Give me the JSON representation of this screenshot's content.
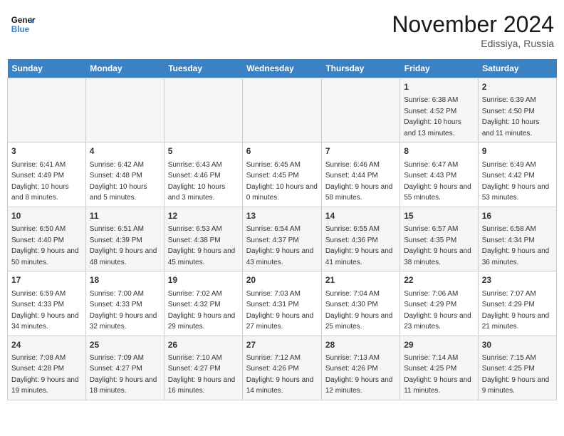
{
  "header": {
    "logo_line1": "General",
    "logo_line2": "Blue",
    "month": "November 2024",
    "location": "Edissiya, Russia"
  },
  "days_of_week": [
    "Sunday",
    "Monday",
    "Tuesday",
    "Wednesday",
    "Thursday",
    "Friday",
    "Saturday"
  ],
  "weeks": [
    [
      {
        "day": "",
        "info": ""
      },
      {
        "day": "",
        "info": ""
      },
      {
        "day": "",
        "info": ""
      },
      {
        "day": "",
        "info": ""
      },
      {
        "day": "",
        "info": ""
      },
      {
        "day": "1",
        "info": "Sunrise: 6:38 AM\nSunset: 4:52 PM\nDaylight: 10 hours and 13 minutes."
      },
      {
        "day": "2",
        "info": "Sunrise: 6:39 AM\nSunset: 4:50 PM\nDaylight: 10 hours and 11 minutes."
      }
    ],
    [
      {
        "day": "3",
        "info": "Sunrise: 6:41 AM\nSunset: 4:49 PM\nDaylight: 10 hours and 8 minutes."
      },
      {
        "day": "4",
        "info": "Sunrise: 6:42 AM\nSunset: 4:48 PM\nDaylight: 10 hours and 5 minutes."
      },
      {
        "day": "5",
        "info": "Sunrise: 6:43 AM\nSunset: 4:46 PM\nDaylight: 10 hours and 3 minutes."
      },
      {
        "day": "6",
        "info": "Sunrise: 6:45 AM\nSunset: 4:45 PM\nDaylight: 10 hours and 0 minutes."
      },
      {
        "day": "7",
        "info": "Sunrise: 6:46 AM\nSunset: 4:44 PM\nDaylight: 9 hours and 58 minutes."
      },
      {
        "day": "8",
        "info": "Sunrise: 6:47 AM\nSunset: 4:43 PM\nDaylight: 9 hours and 55 minutes."
      },
      {
        "day": "9",
        "info": "Sunrise: 6:49 AM\nSunset: 4:42 PM\nDaylight: 9 hours and 53 minutes."
      }
    ],
    [
      {
        "day": "10",
        "info": "Sunrise: 6:50 AM\nSunset: 4:40 PM\nDaylight: 9 hours and 50 minutes."
      },
      {
        "day": "11",
        "info": "Sunrise: 6:51 AM\nSunset: 4:39 PM\nDaylight: 9 hours and 48 minutes."
      },
      {
        "day": "12",
        "info": "Sunrise: 6:53 AM\nSunset: 4:38 PM\nDaylight: 9 hours and 45 minutes."
      },
      {
        "day": "13",
        "info": "Sunrise: 6:54 AM\nSunset: 4:37 PM\nDaylight: 9 hours and 43 minutes."
      },
      {
        "day": "14",
        "info": "Sunrise: 6:55 AM\nSunset: 4:36 PM\nDaylight: 9 hours and 41 minutes."
      },
      {
        "day": "15",
        "info": "Sunrise: 6:57 AM\nSunset: 4:35 PM\nDaylight: 9 hours and 38 minutes."
      },
      {
        "day": "16",
        "info": "Sunrise: 6:58 AM\nSunset: 4:34 PM\nDaylight: 9 hours and 36 minutes."
      }
    ],
    [
      {
        "day": "17",
        "info": "Sunrise: 6:59 AM\nSunset: 4:33 PM\nDaylight: 9 hours and 34 minutes."
      },
      {
        "day": "18",
        "info": "Sunrise: 7:00 AM\nSunset: 4:33 PM\nDaylight: 9 hours and 32 minutes."
      },
      {
        "day": "19",
        "info": "Sunrise: 7:02 AM\nSunset: 4:32 PM\nDaylight: 9 hours and 29 minutes."
      },
      {
        "day": "20",
        "info": "Sunrise: 7:03 AM\nSunset: 4:31 PM\nDaylight: 9 hours and 27 minutes."
      },
      {
        "day": "21",
        "info": "Sunrise: 7:04 AM\nSunset: 4:30 PM\nDaylight: 9 hours and 25 minutes."
      },
      {
        "day": "22",
        "info": "Sunrise: 7:06 AM\nSunset: 4:29 PM\nDaylight: 9 hours and 23 minutes."
      },
      {
        "day": "23",
        "info": "Sunrise: 7:07 AM\nSunset: 4:29 PM\nDaylight: 9 hours and 21 minutes."
      }
    ],
    [
      {
        "day": "24",
        "info": "Sunrise: 7:08 AM\nSunset: 4:28 PM\nDaylight: 9 hours and 19 minutes."
      },
      {
        "day": "25",
        "info": "Sunrise: 7:09 AM\nSunset: 4:27 PM\nDaylight: 9 hours and 18 minutes."
      },
      {
        "day": "26",
        "info": "Sunrise: 7:10 AM\nSunset: 4:27 PM\nDaylight: 9 hours and 16 minutes."
      },
      {
        "day": "27",
        "info": "Sunrise: 7:12 AM\nSunset: 4:26 PM\nDaylight: 9 hours and 14 minutes."
      },
      {
        "day": "28",
        "info": "Sunrise: 7:13 AM\nSunset: 4:26 PM\nDaylight: 9 hours and 12 minutes."
      },
      {
        "day": "29",
        "info": "Sunrise: 7:14 AM\nSunset: 4:25 PM\nDaylight: 9 hours and 11 minutes."
      },
      {
        "day": "30",
        "info": "Sunrise: 7:15 AM\nSunset: 4:25 PM\nDaylight: 9 hours and 9 minutes."
      }
    ]
  ]
}
